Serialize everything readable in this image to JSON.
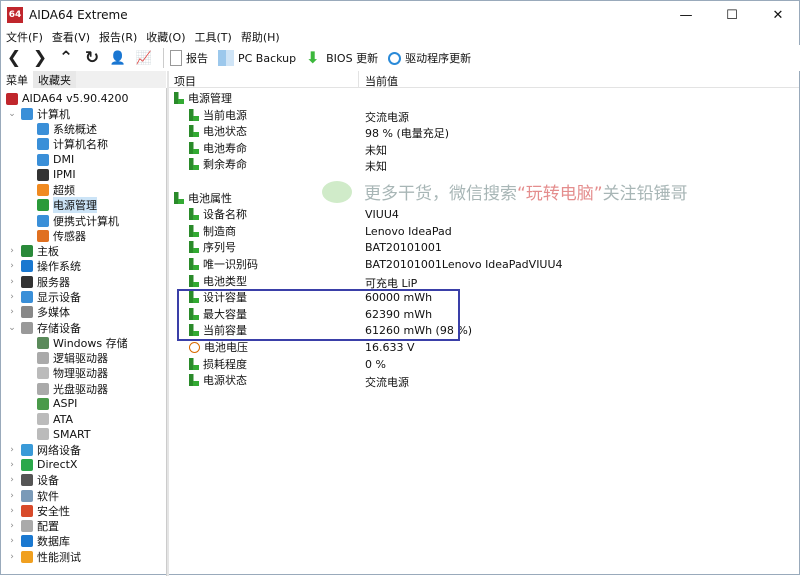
{
  "window": {
    "title": "AIDA64 Extreme",
    "logo": "64",
    "minimize": "—",
    "maximize": "☐",
    "close": "✕"
  },
  "menu": [
    "文件(F)",
    "查看(V)",
    "报告(R)",
    "收藏(O)",
    "工具(T)",
    "帮助(H)"
  ],
  "nav": [
    {
      "icon": "back-icon",
      "glyph": "❮"
    },
    {
      "icon": "forward-icon",
      "glyph": "❯"
    },
    {
      "icon": "up-icon",
      "glyph": "⌃"
    },
    {
      "icon": "refresh-icon",
      "glyph": "↻"
    },
    {
      "icon": "user-icon",
      "glyph": "👤"
    },
    {
      "icon": "chart-icon",
      "glyph": "📈"
    }
  ],
  "toolbar": {
    "report": "报告",
    "pc_backup": "PC Backup",
    "bios_update": "BIOS 更新",
    "driver_update": "驱动程序更新"
  },
  "tabs": {
    "menu": "菜单",
    "favorites": "收藏夹"
  },
  "tree": [
    {
      "label": "AIDA64 v5.90.4200",
      "level": 0,
      "chev": "",
      "icon": "aida64-icon",
      "color": "#c0262c"
    },
    {
      "label": "计算机",
      "level": 1,
      "chev": "⌄",
      "icon": "computer-icon",
      "color": "#3a8fd8"
    },
    {
      "label": "系统概述",
      "level": 2,
      "chev": "",
      "icon": "computer-icon",
      "color": "#3a8fd8"
    },
    {
      "label": "计算机名称",
      "level": 2,
      "chev": "",
      "icon": "computer-icon",
      "color": "#3a8fd8"
    },
    {
      "label": "DMI",
      "level": 2,
      "chev": "",
      "icon": "computer-icon",
      "color": "#3a8fd8"
    },
    {
      "label": "IPMI",
      "level": 2,
      "chev": "",
      "icon": "server-icon",
      "color": "#333"
    },
    {
      "label": "超频",
      "level": 2,
      "chev": "",
      "icon": "flame-icon",
      "color": "#f08a20"
    },
    {
      "label": "电源管理",
      "level": 2,
      "chev": "",
      "icon": "power-icon",
      "color": "#2a9a3a",
      "selected": true
    },
    {
      "label": "便携式计算机",
      "level": 2,
      "chev": "",
      "icon": "laptop-icon",
      "color": "#3a8fd8"
    },
    {
      "label": "传感器",
      "level": 2,
      "chev": "",
      "icon": "sensor-icon",
      "color": "#e07020"
    },
    {
      "label": "主板",
      "level": 1,
      "chev": "›",
      "icon": "motherboard-icon",
      "color": "#2a8a3a"
    },
    {
      "label": "操作系统",
      "level": 1,
      "chev": "›",
      "icon": "windows-icon",
      "color": "#1a78d0"
    },
    {
      "label": "服务器",
      "level": 1,
      "chev": "›",
      "icon": "server-icon",
      "color": "#333"
    },
    {
      "label": "显示设备",
      "level": 1,
      "chev": "›",
      "icon": "display-icon",
      "color": "#3a8fd8"
    },
    {
      "label": "多媒体",
      "level": 1,
      "chev": "›",
      "icon": "multimedia-icon",
      "color": "#888"
    },
    {
      "label": "存储设备",
      "level": 1,
      "chev": "⌄",
      "icon": "storage-icon",
      "color": "#999"
    },
    {
      "label": "Windows 存储",
      "level": 2,
      "chev": "",
      "icon": "drive-icon",
      "color": "#5a8a5a"
    },
    {
      "label": "逻辑驱动器",
      "level": 2,
      "chev": "",
      "icon": "disk-icon",
      "color": "#aaa"
    },
    {
      "label": "物理驱动器",
      "level": 2,
      "chev": "",
      "icon": "drive-icon",
      "color": "#bbb"
    },
    {
      "label": "光盘驱动器",
      "level": 2,
      "chev": "",
      "icon": "optical-icon",
      "color": "#aaa"
    },
    {
      "label": "ASPI",
      "level": 2,
      "chev": "",
      "icon": "aspi-icon",
      "color": "#4a9a4a"
    },
    {
      "label": "ATA",
      "level": 2,
      "chev": "",
      "icon": "drive-icon",
      "color": "#bbb"
    },
    {
      "label": "SMART",
      "level": 2,
      "chev": "",
      "icon": "drive-icon",
      "color": "#bbb"
    },
    {
      "label": "网络设备",
      "level": 1,
      "chev": "›",
      "icon": "network-icon",
      "color": "#3a9ad8"
    },
    {
      "label": "DirectX",
      "level": 1,
      "chev": "›",
      "icon": "xbox-icon",
      "color": "#2aa84a"
    },
    {
      "label": "设备",
      "level": 1,
      "chev": "›",
      "icon": "device-icon",
      "color": "#555"
    },
    {
      "label": "软件",
      "level": 1,
      "chev": "›",
      "icon": "software-icon",
      "color": "#7a9ab8"
    },
    {
      "label": "安全性",
      "level": 1,
      "chev": "›",
      "icon": "shield-icon",
      "color": "#d84a2a"
    },
    {
      "label": "配置",
      "level": 1,
      "chev": "›",
      "icon": "config-icon",
      "color": "#aaa"
    },
    {
      "label": "数据库",
      "level": 1,
      "chev": "›",
      "icon": "database-icon",
      "color": "#1a78d0"
    },
    {
      "label": "性能测试",
      "level": 1,
      "chev": "›",
      "icon": "benchmark-icon",
      "color": "#f0a020"
    }
  ],
  "columns": {
    "item": "项目",
    "value": "当前值"
  },
  "list": [
    {
      "label": "电源管理",
      "value": "",
      "level": 0,
      "icon": "power-icon"
    },
    {
      "label": "当前电源",
      "value": "交流电源",
      "level": 1,
      "icon": "power-icon"
    },
    {
      "label": "电池状态",
      "value": "98 % (电量充足)",
      "level": 1,
      "icon": "power-icon"
    },
    {
      "label": "电池寿命",
      "value": "未知",
      "level": 1,
      "icon": "power-icon"
    },
    {
      "label": "剩余寿命",
      "value": "未知",
      "level": 1,
      "icon": "power-icon"
    },
    null,
    {
      "label": "电池属性",
      "value": "",
      "level": 0,
      "icon": "power-icon"
    },
    {
      "label": "设备名称",
      "value": "VIUU4",
      "level": 1,
      "icon": "power-icon"
    },
    {
      "label": "制造商",
      "value": "Lenovo IdeaPad",
      "level": 1,
      "icon": "power-icon"
    },
    {
      "label": "序列号",
      "value": "BAT20101001",
      "level": 1,
      "icon": "power-icon"
    },
    {
      "label": "唯一识别码",
      "value": "BAT20101001Lenovo IdeaPadVIUU4",
      "level": 1,
      "icon": "power-icon"
    },
    {
      "label": "电池类型",
      "value": "可充电 LiP",
      "level": 1,
      "icon": "power-icon"
    },
    {
      "label": "设计容量",
      "value": "60000 mWh",
      "level": 1,
      "icon": "power-icon"
    },
    {
      "label": "最大容量",
      "value": "62390 mWh",
      "level": 1,
      "icon": "power-icon"
    },
    {
      "label": "当前容量",
      "value": "61260 mWh  (98 %)",
      "level": 1,
      "icon": "power-icon"
    },
    {
      "label": "电池电压",
      "value": "16.633 V",
      "level": 1,
      "icon": "voltage-icon"
    },
    {
      "label": "损耗程度",
      "value": "0 %",
      "level": 1,
      "icon": "power-icon"
    },
    {
      "label": "电源状态",
      "value": "交流电源",
      "level": 1,
      "icon": "power-icon"
    }
  ],
  "watermark": {
    "text1": "更多干货，微信搜索",
    "text2": "“玩转电脑”",
    "text3": "关注铅锤哥"
  },
  "colors": {
    "highlight": "#3a3fa8",
    "selection": "#cce4f7"
  }
}
